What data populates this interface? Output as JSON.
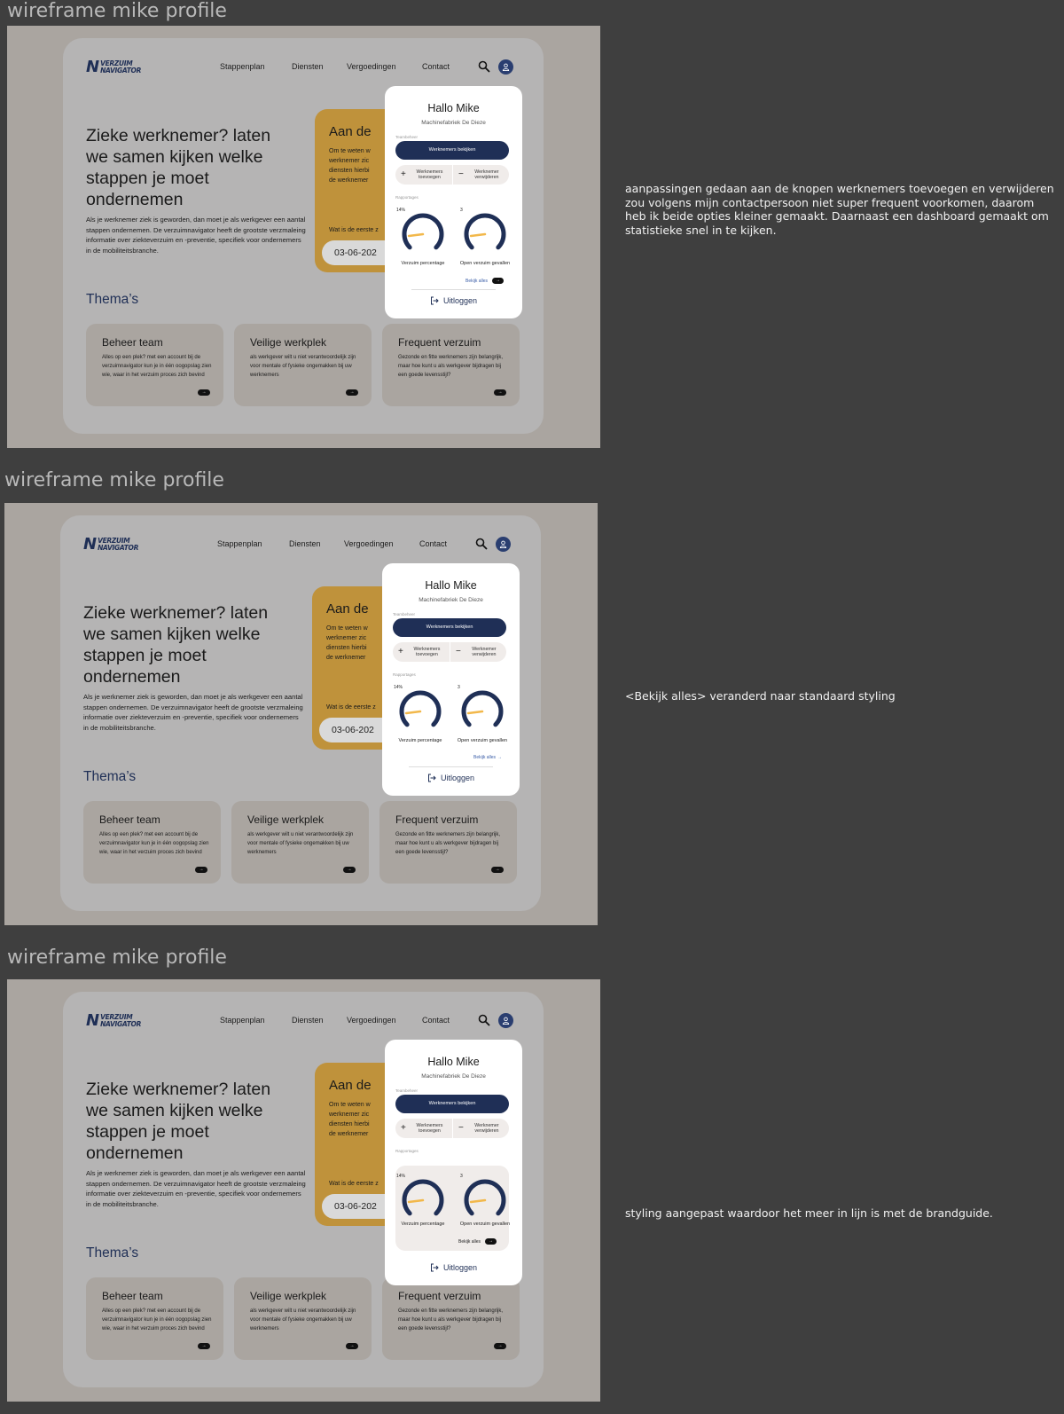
{
  "frames": [
    {
      "title": "wireframe mike profile",
      "nav": [
        "Stappenplan",
        "Diensten",
        "Vergoedingen",
        "Contact"
      ],
      "popup_variant": "link-pill",
      "note": "aanpassingen gedaan aan de knopen werknemers toevoegen en verwijderen zou volgens mijn contactpersoon niet super frequent voorkomen, daarom heb ik beide opties kleiner gemaakt. Daarnaast een dashboard gemaakt om statistieke snel in te kijken."
    },
    {
      "title": "wireframe mike profile",
      "nav": [
        "Stappenplan",
        "Diensten",
        "Vergoedingen",
        "Contact"
      ],
      "popup_variant": "link-text",
      "note": "<Bekijk alles> veranderd naar standaard styling"
    },
    {
      "title": "wireframe mike profile",
      "nav": [
        "Stappenplan",
        "Diensten",
        "Vergoedingen",
        "Contact"
      ],
      "popup_variant": "boxed",
      "note": "styling aangepast waardoor het meer in lijn is met de brandguide."
    }
  ],
  "site": {
    "logo_line1": "VERZUIM",
    "logo_line2": "NAVIGATOR",
    "hero_title": "Zieke werknemer? laten we samen kijken welke stappen je moet ondernemen",
    "hero_text": "Als je werknemer ziek is geworden, dan moet je als werkgever een aantal stappen ondernemen. De verzuimnavigator heeft de grootste verzmaleing informatie over ziekteverzuim en -preventie, specifiek voor ondernemers in de mobiliteitsbranche.",
    "gold_title": "Aan de",
    "gold_text": [
      "Om te weten w",
      "werknemer zic",
      "diensten hierbi",
      "de werknemer"
    ],
    "gold_question": "Wat is de eerste z",
    "gold_date": "03-06-202",
    "themes_title": "Thema’s",
    "themes": [
      {
        "title": "Beheer team",
        "text": "Alles op een plek? met een account bij de verzuimnavigator kun je in één oogopslag zien wie, waar in het verzuim proces zich bevind"
      },
      {
        "title": "Veilige werkplek",
        "text": "als werkgever wilt u niet verantwoordelijk zijn voor mentale of fysieke ongemakken bij uw werknemers"
      },
      {
        "title": "Frequent verzuim",
        "text": "Gezonde en fitte werknemers zijn belangrijk, maar hoe kunt u als werkgever bijdragen bij een goede levensstijl?"
      }
    ]
  },
  "popup": {
    "greeting": "Hallo Mike",
    "company": "Machinefabriek De Dieze",
    "section_team": "Teambeheer",
    "view_button": "Werknemers bekijken",
    "add_label": "Werknemers toevoegen",
    "remove_label": "Werknemer verwijderen",
    "section_reports": "Rapportages",
    "gauge1_value": "14%",
    "gauge1_label": "Verzuim percentage",
    "gauge1_fraction": 0.14,
    "gauge2_value": "3",
    "gauge2_label": "Open verzuim gevallen",
    "see_all": "Bekijk alles",
    "logout": "Uitloggen"
  },
  "colors": {
    "navy": "#1f2f56",
    "gold": "#bf923b",
    "gauge_needle": "#f2b84b"
  }
}
